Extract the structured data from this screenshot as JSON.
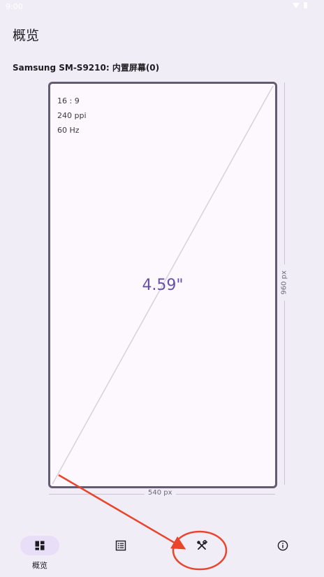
{
  "status_bar": {
    "time": "9:00"
  },
  "header": {
    "title": "概览"
  },
  "display": {
    "device_name": "Samsung SM-S9210: 内置屏幕(0)",
    "aspect_ratio": "16 : 9",
    "density": "240 ppi",
    "refresh_rate": "60 Hz",
    "diagonal": "4.59\"",
    "width_label": "540 px",
    "height_label": "960 px"
  },
  "bottom_nav": {
    "items": [
      {
        "label": "概览",
        "icon": "dashboard-icon",
        "selected": true
      },
      {
        "label": "",
        "icon": "list-icon",
        "selected": false
      },
      {
        "label": "",
        "icon": "tools-icon",
        "selected": false
      },
      {
        "label": "",
        "icon": "info-icon",
        "selected": false
      }
    ]
  },
  "colors": {
    "background": "#f1edf7",
    "accent": "#6750a4",
    "frame": "#625b71",
    "annotation": "#e8452c"
  }
}
